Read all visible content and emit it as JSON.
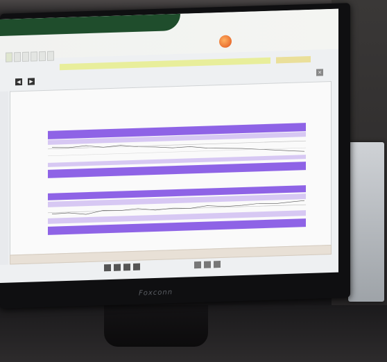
{
  "scene": {
    "description_hint": "",
    "monitor_brand": "Foxconn"
  },
  "app": {
    "logo_left": "",
    "logo_right": "",
    "tabs": [
      "",
      "",
      "",
      "",
      "",
      ""
    ],
    "subrow_label": "",
    "subrow_value": "",
    "toolbar_text_1": "",
    "toolbar_text_2": "",
    "toolbar_text_3": "",
    "chart_title": "",
    "footer_text": "",
    "bottom_text": ""
  },
  "colors": {
    "band_purple": "#8e63e6",
    "band_light": "#d7c8f3",
    "accent_orange": "#e0541d",
    "header_green": "#1f4d2c"
  }
}
